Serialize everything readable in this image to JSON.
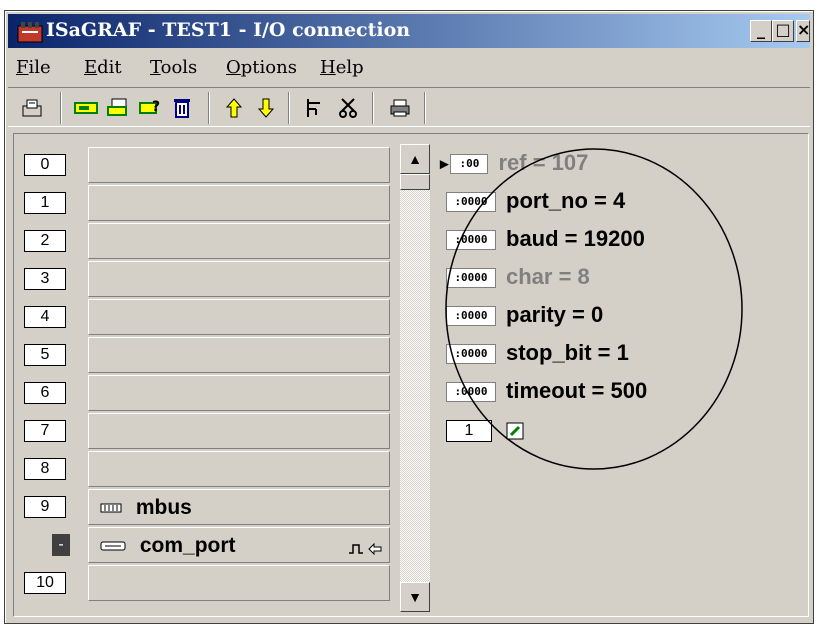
{
  "window": {
    "title": "ISaGRAF - TEST1 - I/O connection",
    "controls": {
      "minimize": "_",
      "maximize": "□",
      "close": "×"
    }
  },
  "menu": [
    {
      "label": "File",
      "ul": "F",
      "rest": "ile"
    },
    {
      "label": "Edit",
      "ul": "E",
      "rest": "dit"
    },
    {
      "label": "Tools",
      "ul": "T",
      "rest": "ools"
    },
    {
      "label": "Options",
      "ul": "O",
      "rest": "ptions"
    },
    {
      "label": "Help",
      "ul": "H",
      "rest": "elp"
    }
  ],
  "toolbar": {
    "icons": [
      "open-icon",
      "board-icon",
      "board-params-icon",
      "edit-params-icon",
      "delete-icon",
      "move-up-icon",
      "move-down-icon",
      "tree-icon",
      "cut-icon",
      "print-icon"
    ]
  },
  "slots": [
    {
      "num": "0",
      "label": ""
    },
    {
      "num": "1",
      "label": ""
    },
    {
      "num": "2",
      "label": ""
    },
    {
      "num": "3",
      "label": ""
    },
    {
      "num": "4",
      "label": ""
    },
    {
      "num": "5",
      "label": ""
    },
    {
      "num": "6",
      "label": ""
    },
    {
      "num": "7",
      "label": ""
    },
    {
      "num": "8",
      "label": ""
    },
    {
      "num": "9",
      "label": "mbus"
    },
    {
      "num": "-",
      "label": "com_port"
    },
    {
      "num": "10",
      "label": ""
    }
  ],
  "params": [
    {
      "text": "ref = 107",
      "dim": true
    },
    {
      "text": "port_no = 4",
      "dim": false
    },
    {
      "text": "baud = 19200",
      "dim": false
    },
    {
      "text": "char = 8",
      "dim": true
    },
    {
      "text": "parity = 0",
      "dim": false
    },
    {
      "text": "stop_bit = 1",
      "dim": false
    },
    {
      "text": "timeout = 500",
      "dim": false
    }
  ],
  "channel": {
    "num": "1"
  },
  "badge_text": ":0000",
  "colors": {
    "title_start": "#0a246a",
    "title_end": "#a6caf0",
    "face": "#d4d0c8"
  }
}
